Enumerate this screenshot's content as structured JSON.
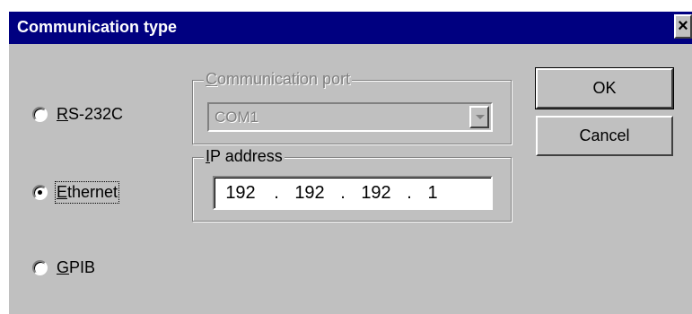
{
  "dialog": {
    "title": "Communication type",
    "close_glyph": "×"
  },
  "connection_types": [
    {
      "label_prefix": "",
      "accel": "R",
      "label_rest": "S-232C",
      "checked": false
    },
    {
      "label_prefix": "",
      "accel": "E",
      "label_rest": "thernet",
      "checked": true
    },
    {
      "label_prefix": "",
      "accel": "G",
      "label_rest": "PIB",
      "checked": false
    }
  ],
  "communication_port": {
    "accel": "C",
    "label_rest": "ommunication port",
    "selected_value": "COM1",
    "enabled": false
  },
  "ip_address": {
    "accel": "I",
    "label_rest": "P address",
    "octets": [
      "192",
      "192",
      "192",
      "1"
    ],
    "separator": "."
  },
  "buttons": {
    "ok": "OK",
    "cancel": "Cancel"
  }
}
